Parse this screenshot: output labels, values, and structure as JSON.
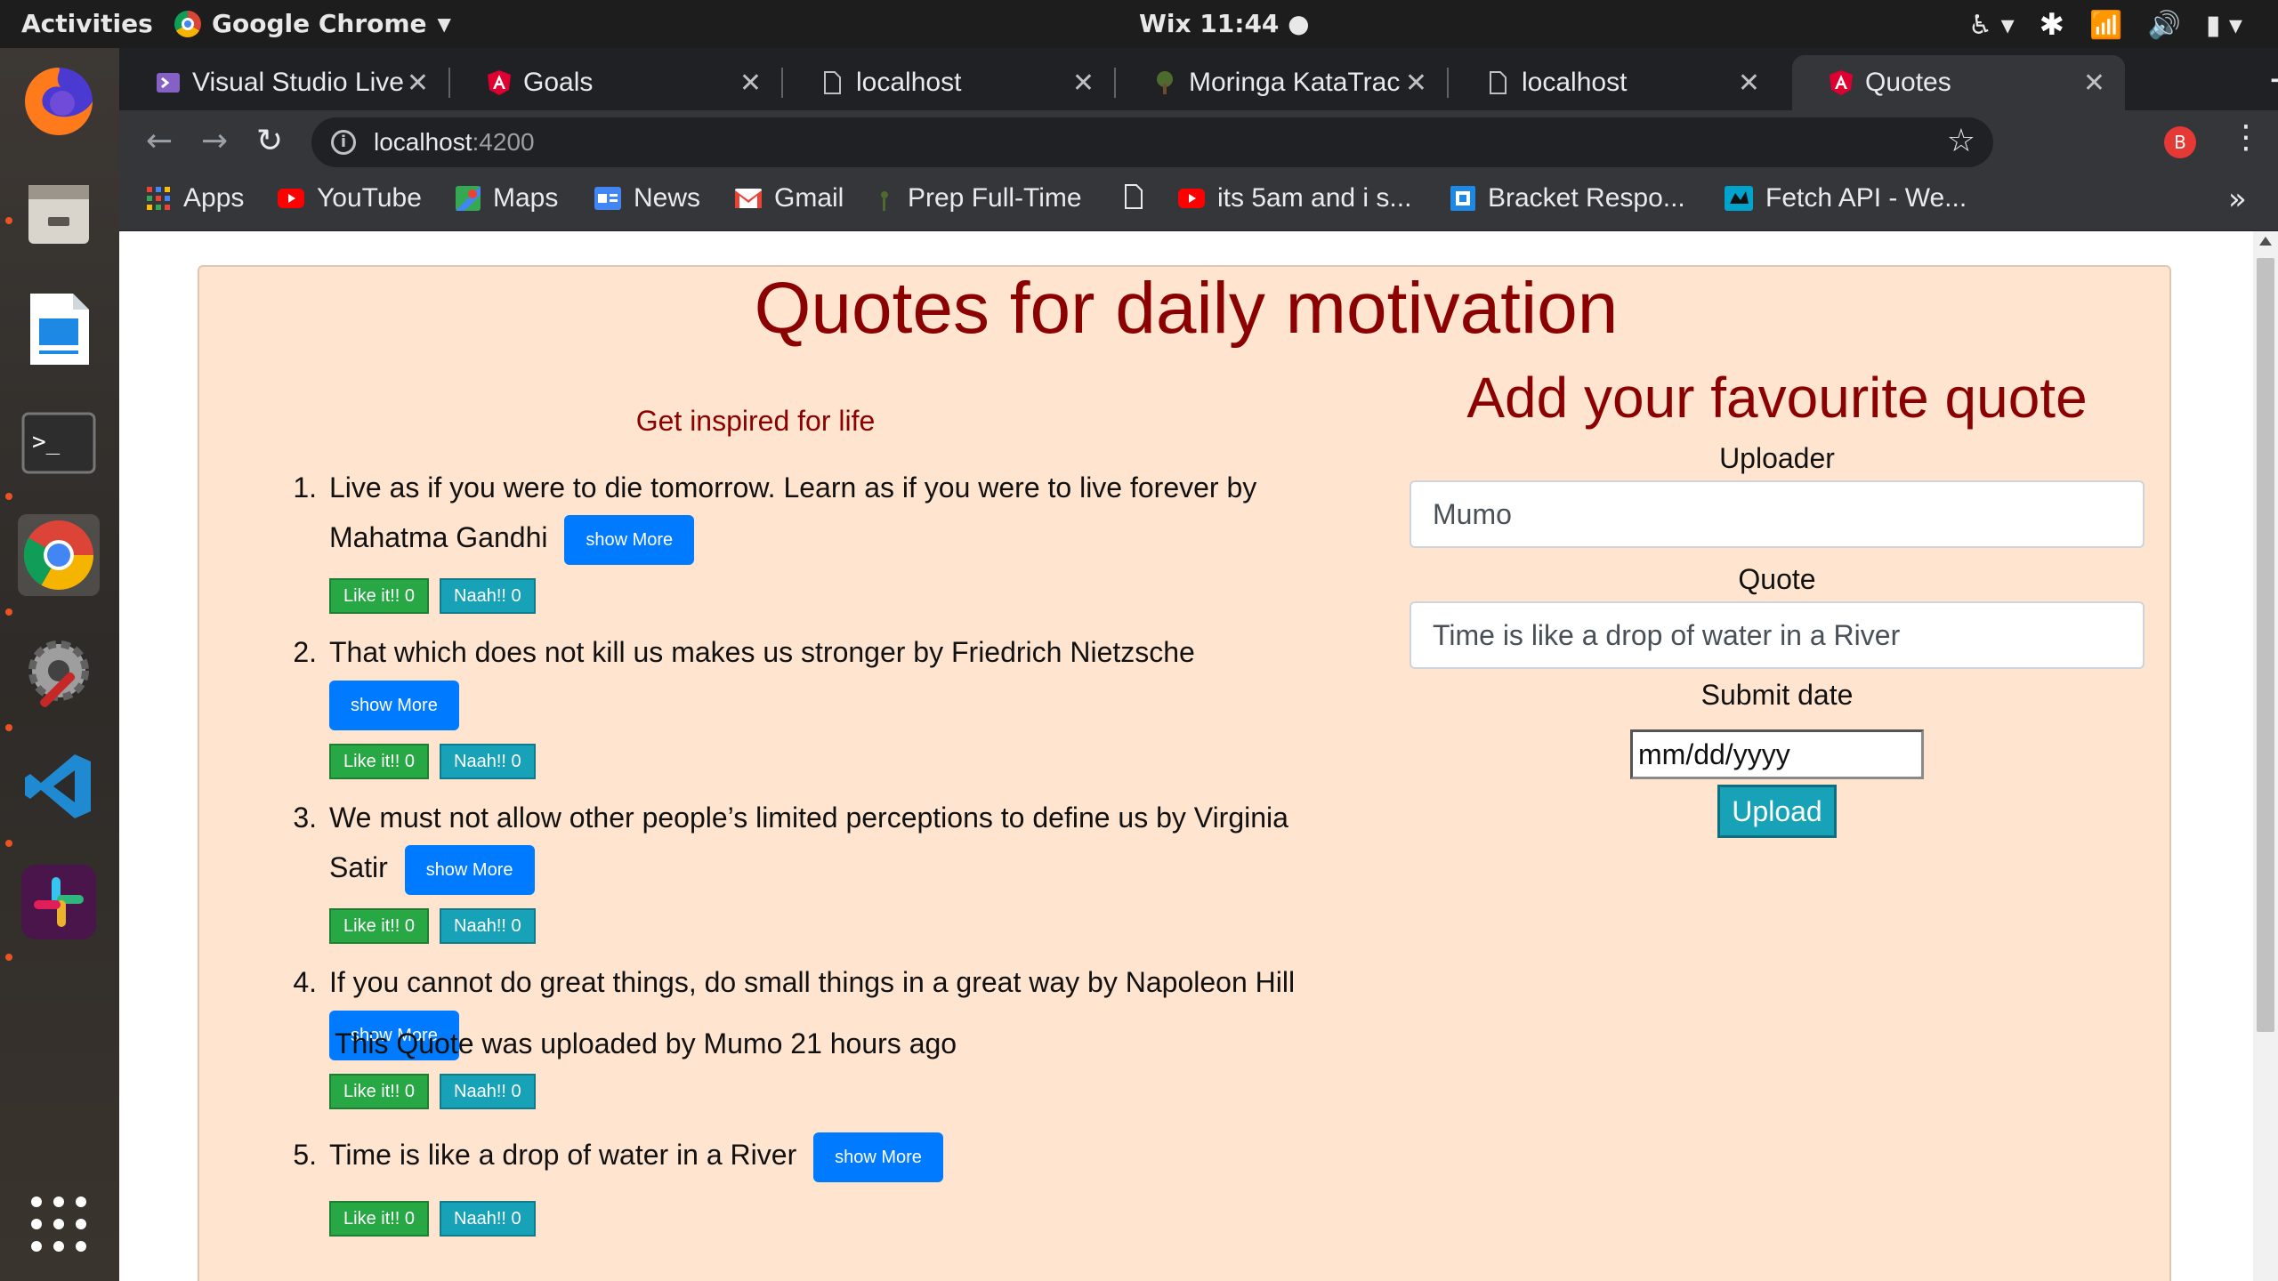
{
  "topbar": {
    "activities": "Activities",
    "app_name": "Google Chrome",
    "clock": "Wix 11:44 ●"
  },
  "tabs": [
    {
      "title": "Visual Studio Live",
      "icon": "vs-live-icon",
      "active": false
    },
    {
      "title": "Goals",
      "icon": "angular-icon",
      "active": false
    },
    {
      "title": "localhost",
      "icon": "page-icon",
      "active": false
    },
    {
      "title": "Moringa KataTrac",
      "icon": "tree-icon",
      "active": false
    },
    {
      "title": "localhost",
      "icon": "page-icon",
      "active": false
    },
    {
      "title": "Quotes",
      "icon": "angular-icon",
      "active": true
    }
  ],
  "omnibox": {
    "host": "localhost",
    "port": ":4200",
    "profile_initial": "B"
  },
  "bookmarks": [
    {
      "label": "Apps",
      "icon": "apps-grid-icon",
      "color": "#ea4335"
    },
    {
      "label": "YouTube",
      "icon": "youtube-icon",
      "color": "#ff0000"
    },
    {
      "label": "Maps",
      "icon": "maps-icon",
      "color": "#34a853"
    },
    {
      "label": "News",
      "icon": "news-icon",
      "color": "#4285f4"
    },
    {
      "label": "Gmail",
      "icon": "gmail-icon",
      "color": "#ea4335"
    },
    {
      "label": "Prep Full-Time",
      "icon": "leaf-icon",
      "color": "#5f6368"
    },
    {
      "label": "",
      "icon": "page-icon",
      "color": "#e8eaed"
    },
    {
      "label": "its 5am and i s...",
      "icon": "youtube-icon",
      "color": "#ff0000"
    },
    {
      "label": "Bracket Respo...",
      "icon": "bracket-icon",
      "color": "#1e88e5"
    },
    {
      "label": "Fetch API - We...",
      "icon": "mdn-icon",
      "color": "#00a3cc"
    }
  ],
  "page": {
    "title": "Quotes for daily motivation",
    "subtitle": "Get inspired for life",
    "show_more_label": "show More",
    "like_label": "Like it!! 0",
    "naah_label": "Naah!! 0",
    "quotes": [
      {
        "num": "1.",
        "line1": "Live as if you were to die tomorrow. Learn as if you were to live forever by",
        "line2": "Mahatma Gandhi"
      },
      {
        "num": "2.",
        "line1": "That which does not kill us makes us stronger by Friedrich Nietzsche",
        "line2": ""
      },
      {
        "num": "3.",
        "line1": "We must not allow other people’s limited perceptions to define us by Virginia",
        "line2": "Satir"
      },
      {
        "num": "4.",
        "line1": "If you cannot do great things, do small things in a great way by Napoleon Hill",
        "line2": ""
      },
      {
        "num": "5.",
        "line1": "Time is like a drop of water in a River",
        "line2": ""
      }
    ],
    "uploaded_text": "This Quote was uploaded by Mumo 21 hours ago"
  },
  "form": {
    "title": "Add your favourite quote",
    "uploader_label": "Uploader",
    "uploader_value": "Mumo",
    "quote_label": "Quote",
    "quote_value": "Time is like a drop of water in a River",
    "date_label": "Submit date",
    "date_placeholder": "mm/dd/yyyy",
    "upload_label": "Upload"
  },
  "colors": {
    "title": "#8b0000",
    "card_bg": "#ffe4cf",
    "show_more": "#007bff",
    "like": "#28a745",
    "naah": "#17a2b8"
  }
}
